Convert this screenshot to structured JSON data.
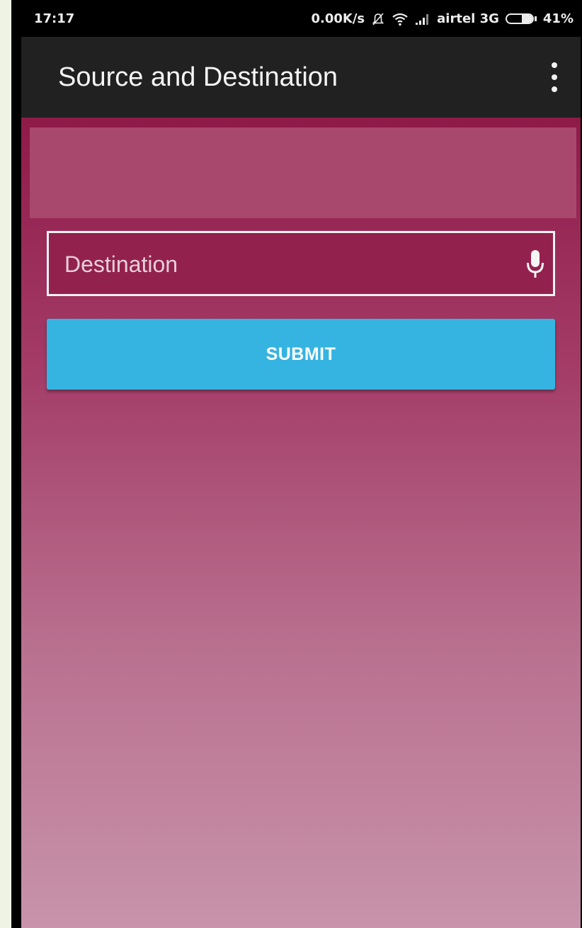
{
  "status_bar": {
    "time": "17:17",
    "net_speed": "0.00K/s",
    "carrier": "airtel 3G",
    "battery": "41%",
    "battery_level": 0.41,
    "icons": [
      "mute-icon",
      "wifi-icon",
      "signal-icon",
      "battery-icon"
    ]
  },
  "app_bar": {
    "title": "Source and Destination",
    "menu_icon": "overflow-menu-icon"
  },
  "form": {
    "destination_placeholder": "Destination",
    "destination_value": "",
    "mic_icon": "microphone-icon",
    "submit_label": "SUBMIT"
  },
  "colors": {
    "app_bar": "#212121",
    "content_top": "#8e1a48",
    "content_bottom": "#c893ab",
    "banner": "#a9486d",
    "submit_button": "#35b4e1"
  }
}
